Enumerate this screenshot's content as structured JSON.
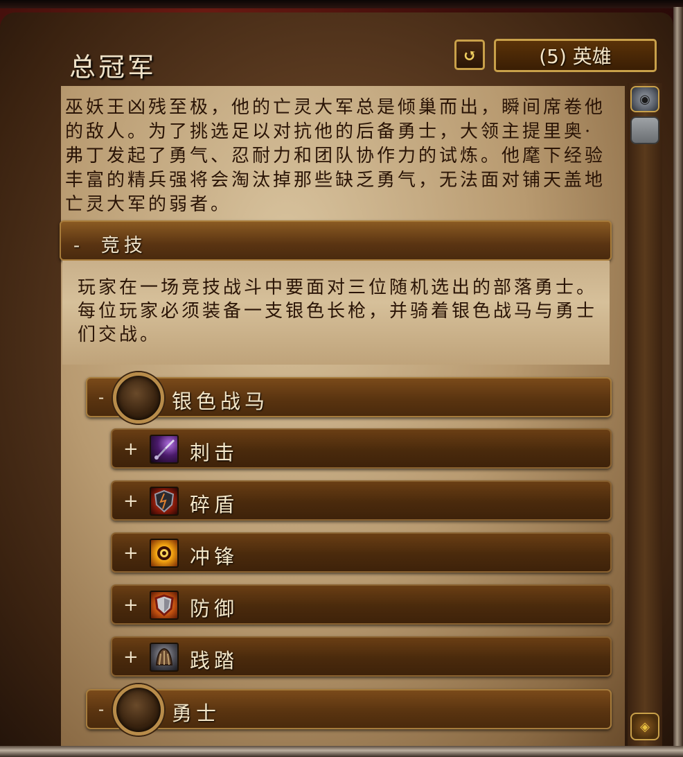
{
  "header": {
    "title": "总冠军",
    "reset_icon": "reset-icon",
    "reset_glyph": "↺",
    "difficulty_label": "(5) 英雄"
  },
  "lore": "巫妖王凶残至极，他的亡灵大军总是倾巢而出，瞬间席卷他的敌人。为了挑选足以对抗他的后备勇士，大领主提里奥·弗丁发起了勇气、忍耐力和团队协作力的试炼。他麾下经验丰富的精兵强将会淘汰掉那些缺乏勇气，无法面对铺天盖地亡灵大军的弱者。",
  "section": {
    "toggle": "-",
    "title": "竞技",
    "description": "玩家在一场竞技战斗中要面对三位随机选出的部落勇士。每位玩家必须装备一支银色长枪，并骑着银色战马与勇士们交战。"
  },
  "encounters": [
    {
      "toggle": "-",
      "label": "银色战马"
    },
    {
      "toggle": "-",
      "label": "勇士"
    }
  ],
  "abilities": [
    {
      "toggle": "+",
      "label": "刺击",
      "icon": "spear-icon"
    },
    {
      "toggle": "+",
      "label": "碎盾",
      "icon": "shield-break-icon"
    },
    {
      "toggle": "+",
      "label": "冲锋",
      "icon": "charge-icon"
    },
    {
      "toggle": "+",
      "label": "防御",
      "icon": "defend-shield-icon"
    },
    {
      "toggle": "+",
      "label": "践踏",
      "icon": "trample-icon"
    }
  ],
  "scrollbar": {
    "up_glyph": "◉",
    "down_glyph": "◈"
  },
  "colors": {
    "text_light": "#f3e6c8",
    "text_dark": "#2a1406",
    "gold_border": "#c9a14a"
  }
}
